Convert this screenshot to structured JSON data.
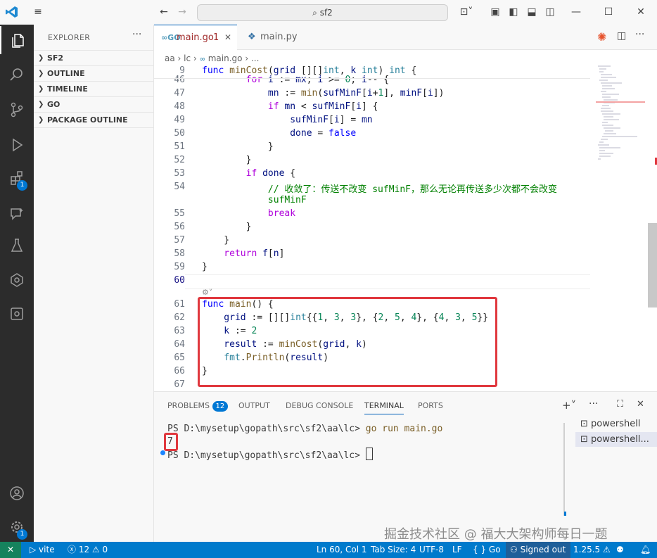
{
  "title_bar": {
    "search_text": "sf2"
  },
  "sidebar": {
    "header": "EXPLORER",
    "sections": [
      {
        "label": "SF2"
      },
      {
        "label": "OUTLINE"
      },
      {
        "label": "TIMELINE"
      },
      {
        "label": "GO"
      },
      {
        "label": "PACKAGE OUTLINE"
      }
    ]
  },
  "activity_bar": {
    "extensions_badge": "1",
    "settings_badge": "1"
  },
  "tabs": [
    {
      "label": "main.go",
      "modified_count": "1"
    },
    {
      "label": "main.py"
    }
  ],
  "breadcrumb": [
    "aa",
    "lc",
    "main.go",
    "..."
  ],
  "editor": {
    "lines": [
      {
        "n": "9",
        "tokens": [
          [
            "kw",
            "func "
          ],
          [
            "fn",
            "minCost"
          ],
          [
            "",
            "("
          ],
          [
            "var",
            "grid "
          ],
          [
            "",
            "[][]"
          ],
          [
            "ty",
            "int"
          ],
          [
            "",
            ", "
          ],
          [
            "var",
            "k "
          ],
          [
            "ty",
            "int"
          ],
          [
            "",
            ") "
          ],
          [
            "ty",
            "int"
          ],
          [
            "",
            " {"
          ]
        ]
      },
      {
        "n": "46",
        "tokens": [
          [
            "kw2",
            "        for "
          ],
          [
            "var",
            "i "
          ],
          [
            "",
            ":= "
          ],
          [
            "var",
            "mx"
          ],
          [
            "",
            "; "
          ],
          [
            "var",
            "i "
          ],
          [
            "",
            ">= "
          ],
          [
            "num",
            "0"
          ],
          [
            "",
            "; "
          ],
          [
            "var",
            "i"
          ],
          [
            "",
            "-- {"
          ]
        ]
      },
      {
        "n": "47",
        "tokens": [
          [
            "var",
            "            mn "
          ],
          [
            "",
            ":= "
          ],
          [
            "fn",
            "min"
          ],
          [
            "",
            "("
          ],
          [
            "var",
            "sufMinF"
          ],
          [
            "",
            "["
          ],
          [
            "var",
            "i"
          ],
          [
            "",
            "+"
          ],
          [
            "num",
            "1"
          ],
          [
            "",
            "], "
          ],
          [
            "var",
            "minF"
          ],
          [
            "",
            "["
          ],
          [
            "var",
            "i"
          ],
          [
            "",
            "])"
          ]
        ]
      },
      {
        "n": "48",
        "tokens": [
          [
            "kw2",
            "            if "
          ],
          [
            "var",
            "mn "
          ],
          [
            "",
            "< "
          ],
          [
            "var",
            "sufMinF"
          ],
          [
            "",
            "["
          ],
          [
            "var",
            "i"
          ],
          [
            "",
            "] {"
          ]
        ]
      },
      {
        "n": "49",
        "tokens": [
          [
            "var",
            "                sufMinF"
          ],
          [
            "",
            "["
          ],
          [
            "var",
            "i"
          ],
          [
            "",
            "] = "
          ],
          [
            "var",
            "mn"
          ]
        ]
      },
      {
        "n": "50",
        "tokens": [
          [
            "var",
            "                done "
          ],
          [
            "",
            "= "
          ],
          [
            "kw",
            "false"
          ]
        ]
      },
      {
        "n": "51",
        "tokens": [
          [
            "",
            "            }"
          ]
        ]
      },
      {
        "n": "52",
        "tokens": [
          [
            "",
            "        }"
          ]
        ]
      },
      {
        "n": "53",
        "tokens": [
          [
            "kw2",
            "        if "
          ],
          [
            "var",
            "done "
          ],
          [
            "",
            "{"
          ]
        ]
      },
      {
        "n": "54",
        "tokens": [
          [
            "cm",
            "            // 收敛了：传送不改变 sufMinF，那么无论再传送多少次都不会改变"
          ]
        ]
      },
      {
        "n": "",
        "tokens": [
          [
            "cm",
            "            sufMinF"
          ]
        ]
      },
      {
        "n": "55",
        "tokens": [
          [
            "kw2",
            "            break"
          ]
        ]
      },
      {
        "n": "56",
        "tokens": [
          [
            "",
            "        }"
          ]
        ]
      },
      {
        "n": "57",
        "tokens": [
          [
            "",
            "    }"
          ]
        ]
      },
      {
        "n": "58",
        "tokens": [
          [
            "kw2",
            "    return "
          ],
          [
            "var",
            "f"
          ],
          [
            "",
            "["
          ],
          [
            "var",
            "n"
          ],
          [
            "",
            "]"
          ]
        ]
      },
      {
        "n": "59",
        "tokens": [
          [
            "",
            "}"
          ]
        ]
      },
      {
        "n": "60",
        "tokens": [
          [
            "",
            ""
          ]
        ]
      },
      {
        "n": "61",
        "tokens": [
          [
            "kw",
            "func "
          ],
          [
            "fn",
            "main"
          ],
          [
            "",
            "() {"
          ]
        ]
      },
      {
        "n": "62",
        "tokens": [
          [
            "var",
            "    grid "
          ],
          [
            "",
            ":= [][]"
          ],
          [
            "ty",
            "int"
          ],
          [
            "",
            "{{"
          ],
          [
            "num",
            "1"
          ],
          [
            "",
            ", "
          ],
          [
            "num",
            "3"
          ],
          [
            "",
            ", "
          ],
          [
            "num",
            "3"
          ],
          [
            "",
            "}, {"
          ],
          [
            "num",
            "2"
          ],
          [
            "",
            ", "
          ],
          [
            "num",
            "5"
          ],
          [
            "",
            ", "
          ],
          [
            "num",
            "4"
          ],
          [
            "",
            "}, {"
          ],
          [
            "num",
            "4"
          ],
          [
            "",
            ", "
          ],
          [
            "num",
            "3"
          ],
          [
            "",
            ", "
          ],
          [
            "num",
            "5"
          ],
          [
            "",
            "}}"
          ]
        ]
      },
      {
        "n": "63",
        "tokens": [
          [
            "var",
            "    k "
          ],
          [
            "",
            ":= "
          ],
          [
            "num",
            "2"
          ]
        ]
      },
      {
        "n": "64",
        "tokens": [
          [
            "var",
            "    result "
          ],
          [
            "",
            ":= "
          ],
          [
            "fn",
            "minCost"
          ],
          [
            "",
            "("
          ],
          [
            "var",
            "grid"
          ],
          [
            "",
            ", "
          ],
          [
            "var",
            "k"
          ],
          [
            "",
            ")"
          ]
        ]
      },
      {
        "n": "65",
        "tokens": [
          [
            "pk",
            "    fmt"
          ],
          [
            "",
            "."
          ],
          [
            "fn",
            "Println"
          ],
          [
            "",
            "("
          ],
          [
            "var",
            "result"
          ],
          [
            "",
            ")"
          ]
        ]
      },
      {
        "n": "66",
        "tokens": [
          [
            "",
            "}"
          ]
        ]
      },
      {
        "n": "67",
        "tokens": [
          [
            "",
            ""
          ]
        ]
      }
    ]
  },
  "panel": {
    "tabs": [
      {
        "label": "PROBLEMS",
        "badge": "12"
      },
      {
        "label": "OUTPUT"
      },
      {
        "label": "DEBUG CONSOLE"
      },
      {
        "label": "TERMINAL"
      },
      {
        "label": "PORTS"
      }
    ],
    "terminal_lines": [
      {
        "prompt": "PS D:\\mysetup\\gopath\\src\\sf2\\aa\\lc> ",
        "cmd": "go run main.go"
      },
      {
        "prompt": "7",
        "cmd": ""
      },
      {
        "prompt": "PS D:\\mysetup\\gopath\\src\\sf2\\aa\\lc> ",
        "cmd": ""
      }
    ],
    "terminals": [
      "powershell",
      "powershell..."
    ]
  },
  "status_bar": {
    "remote": "✕",
    "launch": "vite",
    "errors": "12",
    "warnings": "0",
    "position": "Ln 60, Col 1",
    "tab_size": "Tab Size: 4",
    "encoding": "UTF-8",
    "eol": "LF",
    "language": "Go",
    "account": "Signed out",
    "go_version": "1.25.5"
  },
  "watermark": "掘金技术社区 @ 福大大架构师每日一题",
  "colors": {
    "accent": "#007acc",
    "highlight": "#e0383e"
  }
}
